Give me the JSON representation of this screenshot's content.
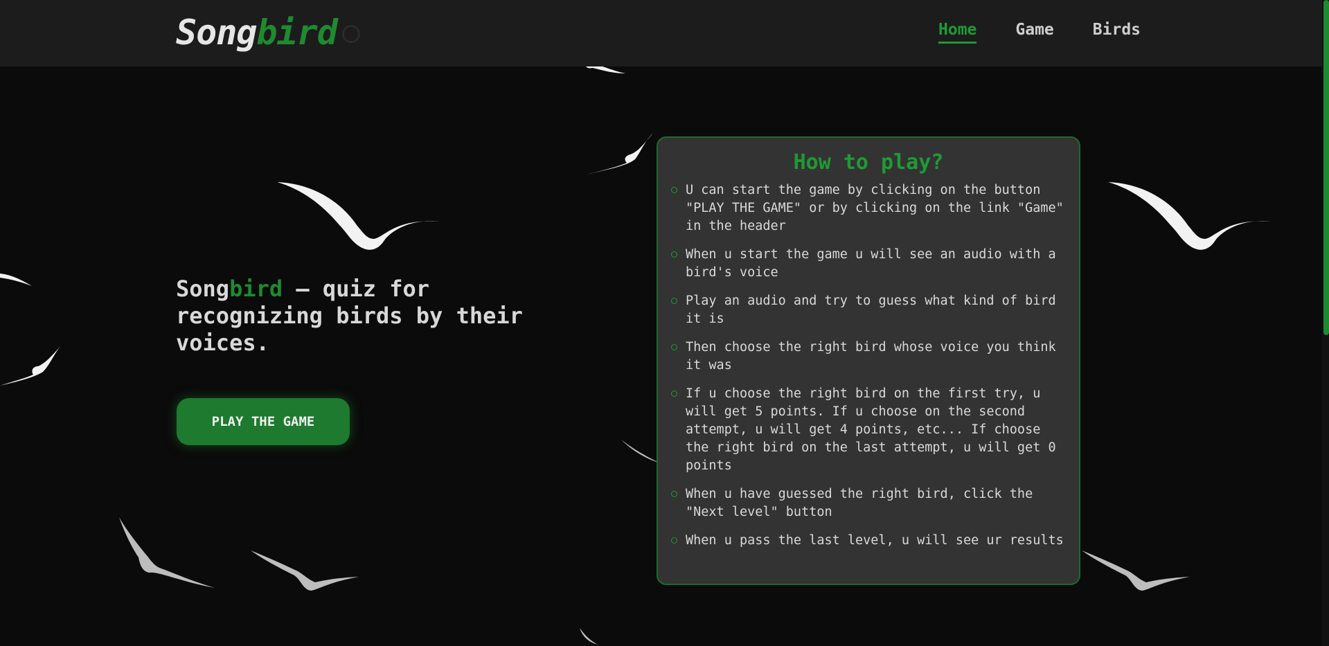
{
  "header": {
    "logo": {
      "part1": "Song",
      "part2": "bird"
    },
    "nav": [
      {
        "label": "Home",
        "active": true
      },
      {
        "label": "Game",
        "active": false
      },
      {
        "label": "Birds",
        "active": false
      }
    ]
  },
  "hero": {
    "title_accent_part1": "Song",
    "title_accent_part2": "bird",
    "title_rest": " — quiz for recognizing birds by their voices.",
    "button_label": "PLAY THE GAME"
  },
  "how_to": {
    "title": "How to play?",
    "rules": [
      "U can start the game by clicking on the button \"PLAY THE GAME\" or by clicking on the link \"Game\" in the header",
      "When u start the game u will see an audio with a bird's voice",
      "Play an audio and try to guess what kind of bird it is",
      "Then choose the right bird whose voice you think it was",
      "If u choose the right bird on the first try, u will get 5 points. If u choose on the second attempt, u will get 4 points, etc... If choose the right bird on the last attempt, u will get 0 points",
      "When u have guessed the right bird, click the \"Next level\" button",
      "When u pass the last level, u will see ur results"
    ]
  },
  "colors": {
    "accent": "#1f8a30",
    "background": "#0b0b0b",
    "header": "#1c1c1c",
    "panel": "#333333"
  }
}
